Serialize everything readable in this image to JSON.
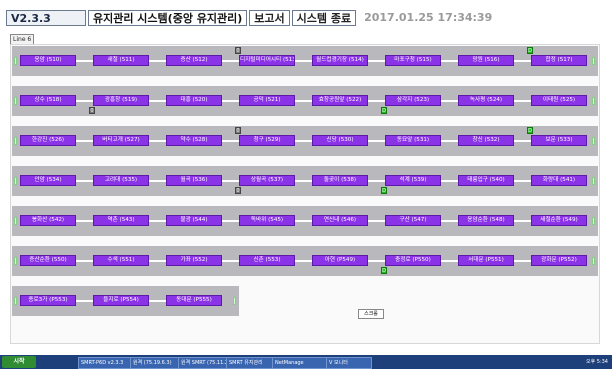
{
  "header": {
    "version": "V2.3.3",
    "tabs": [
      "유지관리 시스템(중앙 유지관리)",
      "보고서",
      "시스템 종료"
    ],
    "clock": "2017.01.25 17:34:39"
  },
  "line_label": "Line 6",
  "rows": [
    [
      "응암 (510)",
      "새절 (511)",
      "증산 (512)",
      "디지털미디어시티 (513)",
      "월드컵경기장 (514)",
      "마포구청 (515)",
      "망원 (516)",
      "합정 (517)"
    ],
    [
      "상수 (518)",
      "광흥창 (519)",
      "대흥 (520)",
      "공덕 (521)",
      "효창공원앞 (522)",
      "삼각지 (523)",
      "녹사평 (524)",
      "이태원 (525)"
    ],
    [
      "한강진 (526)",
      "버티고개 (527)",
      "약수 (528)",
      "청구 (529)",
      "신당 (530)",
      "동묘앞 (531)",
      "창신 (532)",
      "보문 (533)"
    ],
    [
      "안암 (534)",
      "고려대 (535)",
      "월곡 (536)",
      "상월곡 (537)",
      "돌곶이 (538)",
      "석계 (539)",
      "태릉입구 (540)",
      "화랑대 (541)"
    ],
    [
      "봉화산 (542)",
      "역촌 (543)",
      "불광 (544)",
      "독바위 (545)",
      "연신내 (546)",
      "구산 (547)",
      "응암순환 (548)",
      "새절순환 (549)"
    ],
    [
      "증산순환 (550)",
      "수색 (551)",
      "가좌 (552)",
      "신촌 (553)",
      "아현 (P549)",
      "충정로 (P550)",
      "서대문 (P551)",
      "광화문 (P552)"
    ],
    [
      "종로3가 (P553)",
      "을지로 (P554)",
      "동대문 (P555)"
    ]
  ],
  "badges": [
    {
      "row": 0,
      "col": 3,
      "kind": "gray",
      "text": "0"
    },
    {
      "row": 0,
      "col": 7,
      "kind": "green",
      "text": "D"
    },
    {
      "row": 1,
      "col": 1,
      "kind": "gray",
      "text": "0"
    },
    {
      "row": 1,
      "col": 5,
      "kind": "green",
      "text": "D"
    },
    {
      "row": 2,
      "col": 3,
      "kind": "gray",
      "text": "0"
    },
    {
      "row": 2,
      "col": 7,
      "kind": "green",
      "text": "D"
    },
    {
      "row": 3,
      "col": 3,
      "kind": "gray",
      "text": "0"
    },
    {
      "row": 3,
      "col": 5,
      "kind": "green",
      "text": "D"
    },
    {
      "row": 5,
      "col": 5,
      "kind": "green",
      "text": "D"
    }
  ],
  "colors": {
    "station": "#8b33e6",
    "row_bg": "#b9b9bd",
    "edge": "#ccffcc"
  },
  "mini_button": "스크롤",
  "taskbar": {
    "start": "시작",
    "tasks": [
      "SMRT-P6D v2.3.3",
      "원격 (75.19.6.3)",
      "원격 SMRT (75.11.23)",
      "SMRT 유지관리",
      "NetManage",
      "V 모니터"
    ],
    "tray": "오후 5:34"
  }
}
